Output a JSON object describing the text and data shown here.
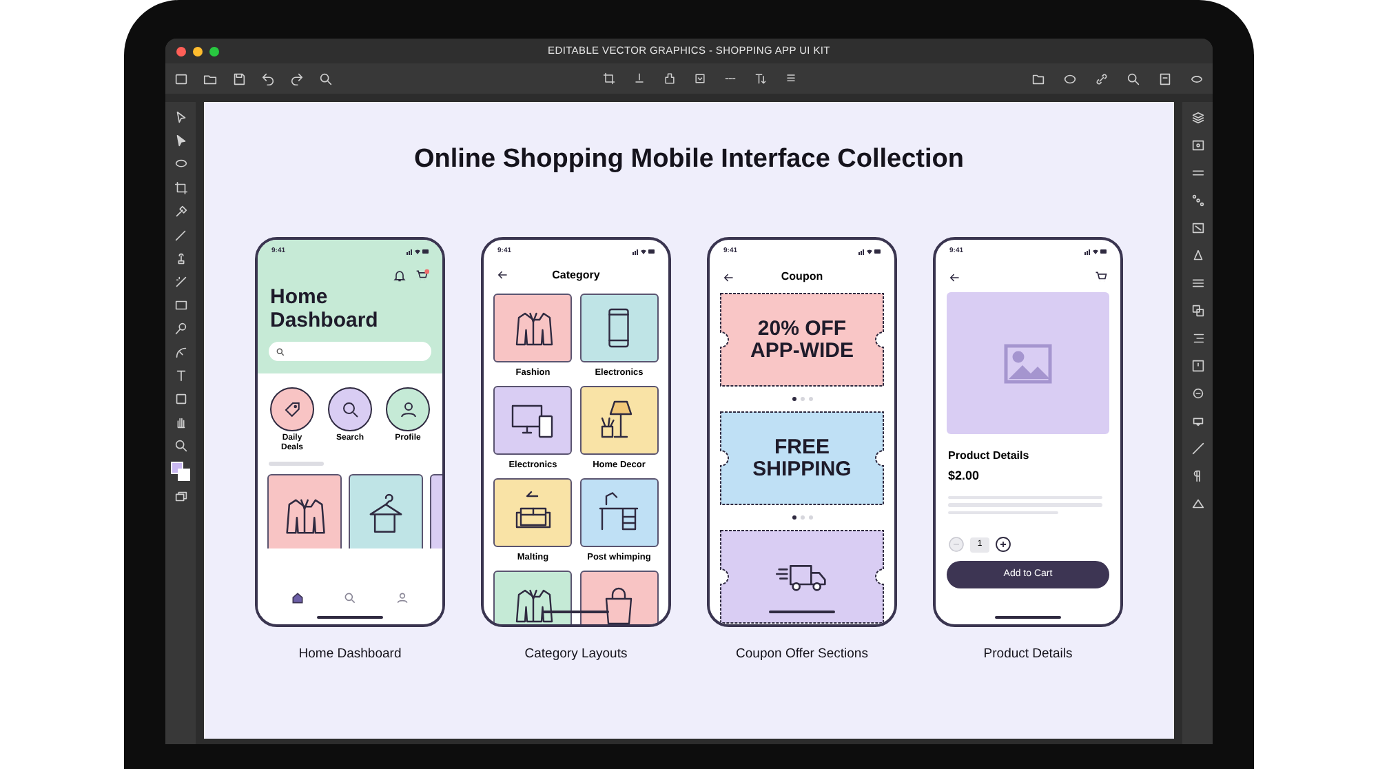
{
  "window": {
    "title": "EDITABLE VECTOR GRAPHICS - SHOPPING APP UI KIT"
  },
  "canvas": {
    "heading": "Online Shopping Mobile Interface Collection",
    "phones": [
      {
        "kind": "home",
        "time": "9:41",
        "title": "Home Dashboard",
        "caption": "Home Dashboard",
        "actions": [
          {
            "label": "Daily Deals",
            "color": "#f8c4c4",
            "kind": "tag"
          },
          {
            "label": "Search",
            "color": "#d9cdf3",
            "kind": "search"
          },
          {
            "label": "Profile",
            "color": "#c5ead6",
            "kind": "profile"
          }
        ],
        "tiles": [
          {
            "color": "#f8c4c4",
            "kind": "coat"
          },
          {
            "color": "#bfe4e6",
            "kind": "hanger"
          },
          {
            "color": "#d9cdf3",
            "kind": "blank"
          }
        ],
        "nav": [
          {
            "kind": "home",
            "selected": true
          },
          {
            "kind": "search",
            "selected": false
          },
          {
            "kind": "profile",
            "selected": false
          }
        ]
      },
      {
        "kind": "category",
        "time": "9:41",
        "title": "Category",
        "caption": "Category Layouts",
        "items": [
          {
            "label": "Fashion",
            "color": "#f8c4c4",
            "kind": "coat"
          },
          {
            "label": "Electronics",
            "color": "#bfe4e6",
            "kind": "phone"
          },
          {
            "label": "Electronics",
            "color": "#d9cdf3",
            "kind": "monitor"
          },
          {
            "label": "Home Decor",
            "color": "#f9e3a6",
            "kind": "lamp"
          },
          {
            "label": "Malting",
            "color": "#f9e3a6",
            "kind": "sofa"
          },
          {
            "label": "Post whimping",
            "color": "#bfe0f5",
            "kind": "desk"
          },
          {
            "color": "#c5ead6",
            "kind": "coat"
          },
          {
            "color": "#f8c4c4",
            "kind": "bag"
          }
        ]
      },
      {
        "kind": "coupon",
        "time": "9:41",
        "title": "Coupon",
        "caption": "Coupon Offer Sections",
        "coupons": [
          {
            "text": "20% OFF APP-WIDE",
            "color": "#f9c6c6",
            "dots": [
              {
                "selected": true
              },
              {
                "selected": false
              },
              {
                "selected": false
              }
            ]
          },
          {
            "text": "FREE SHIPPING",
            "color": "#bfe0f5",
            "dots": [
              {
                "selected": true
              },
              {
                "selected": false
              },
              {
                "selected": false
              }
            ]
          },
          {
            "kind": "truck",
            "color": "#d9cdf3"
          }
        ]
      },
      {
        "kind": "product",
        "time": "9:41",
        "title": "Product Details",
        "price": "$2.00",
        "quantity": "1",
        "button": "Add to Cart",
        "caption": "Product Details"
      }
    ]
  }
}
